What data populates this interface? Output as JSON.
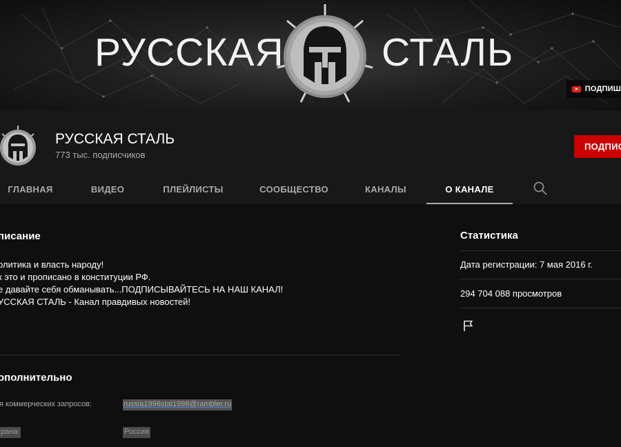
{
  "banner": {
    "word_left": "РУССКАЯ",
    "word_right": "СТАЛЬ",
    "subscribe_label": "ПОДПИШ",
    "emblem_icon": "spartan-helmet-icon"
  },
  "channel": {
    "name": "РУССКАЯ СТАЛЬ",
    "subscribers": "773 тыс. подписчиков",
    "subscribe_button": "ПОДПИС",
    "avatar_icon": "spartan-helmet-icon"
  },
  "tabs": [
    {
      "label": "ГЛАВНАЯ"
    },
    {
      "label": "ВИДЕО"
    },
    {
      "label": "ПЛЕЙЛИСТЫ"
    },
    {
      "label": "СООБЩЕСТВО"
    },
    {
      "label": "КАНАЛЫ"
    },
    {
      "label": "О КАНАЛЕ"
    }
  ],
  "active_tab": "О КАНАЛЕ",
  "search_icon": "search-icon",
  "about": {
    "description_title": "писание",
    "description_lines": [
      "олитика и власть народу!",
      "к это и прописано в конституции РФ.",
      "е давайте себя обманывать...ПОДПИСЫВАЙТЕСЬ НА НАШ КАНАЛ!",
      "УССКАЯ СТАЛЬ - Канал правдивых новостей!"
    ],
    "details_title": "ополнительно",
    "business_label": "я коммерческих запросов:",
    "business_email": "russia1996stal1998@rambler.ru",
    "country_label": "рана:",
    "country_value": "Россия"
  },
  "stats": {
    "title": "Статистика",
    "joined": "Дата регистрации: 7 мая 2016 г.",
    "views": "294 704 088 просмотров",
    "report_icon": "flag-icon"
  },
  "colors": {
    "background": "#181818",
    "content_background": "#0f0f0f",
    "subscribe_red": "#cc0000",
    "muted_text": "#aaaaaa"
  }
}
